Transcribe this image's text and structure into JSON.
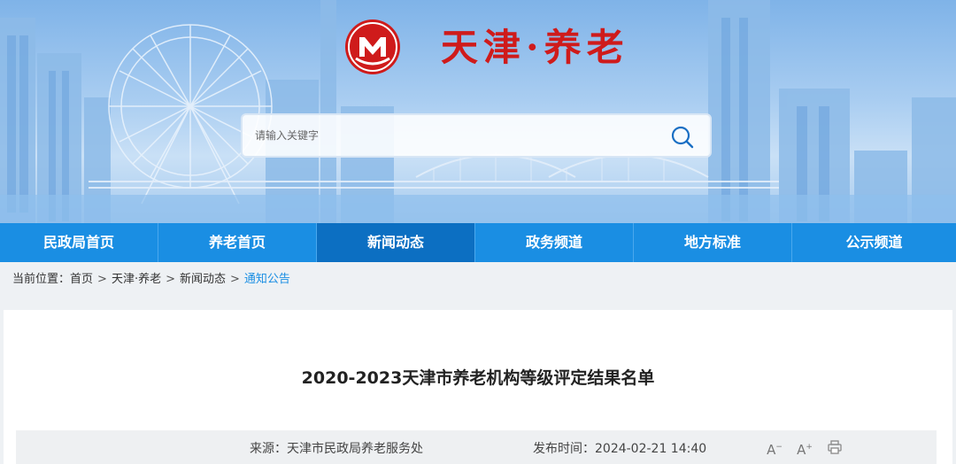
{
  "header": {
    "site_title": "天津·养老",
    "logo_icon": "tianjin-civil-affairs-logo",
    "brand_color": "#cf1b1b"
  },
  "search": {
    "placeholder": "请输入关键字",
    "icon": "search-icon"
  },
  "nav": {
    "items": [
      {
        "label": "民政局首页"
      },
      {
        "label": "养老首页"
      },
      {
        "label": "新闻动态",
        "active": true
      },
      {
        "label": "政务频道"
      },
      {
        "label": "地方标准"
      },
      {
        "label": "公示频道"
      }
    ],
    "bg_color": "#1a8ee3",
    "active_color": "#0c6fc2"
  },
  "breadcrumb": {
    "prefix": "当前位置：",
    "items": [
      "首页",
      "天津·养老",
      "新闻动态",
      "通知公告"
    ],
    "separator": ">"
  },
  "article": {
    "title": "2020-2023天津市养老机构等级评定结果名单",
    "source": "来源：天津市民政局养老服务处",
    "published": "发布时间：2024-02-21 14:40",
    "tools": {
      "font_decrease": "A",
      "font_increase": "A",
      "decrease_mark": "−",
      "increase_mark": "+"
    }
  }
}
